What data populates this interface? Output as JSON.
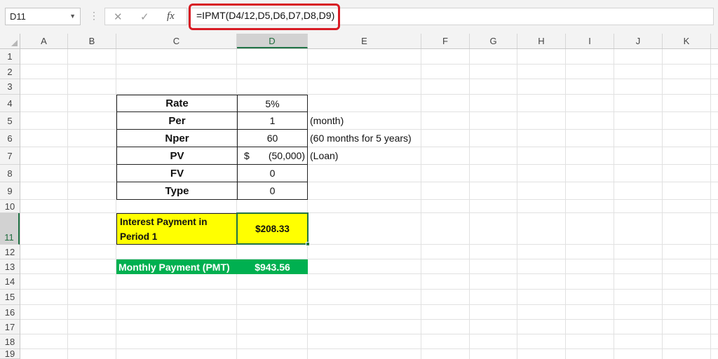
{
  "formula_bar": {
    "name_box": "D11",
    "cancel_icon": "✕",
    "enter_icon": "✓",
    "fx_label": "fx",
    "formula": "=IPMT(D4/12,D5,D6,D7,D8,D9)"
  },
  "columns": [
    "A",
    "B",
    "C",
    "D",
    "E",
    "F",
    "G",
    "H",
    "I",
    "J",
    "K"
  ],
  "rows": [
    "1",
    "2",
    "3",
    "4",
    "5",
    "6",
    "7",
    "8",
    "9",
    "10",
    "11",
    "12",
    "13",
    "14",
    "15",
    "16",
    "17",
    "18",
    "19"
  ],
  "selected_cell": {
    "column": "D",
    "row": "11"
  },
  "table": {
    "rate": {
      "label": "Rate",
      "value": "5%"
    },
    "per": {
      "label": "Per",
      "value": "1",
      "note": "(month)"
    },
    "nper": {
      "label": "Nper",
      "value": "60",
      "note": "(60 months for 5 years)"
    },
    "pv": {
      "label": "PV",
      "currency": "$",
      "value": "(50,000)",
      "note": "(Loan)"
    },
    "fv": {
      "label": "FV",
      "value": "0"
    },
    "type": {
      "label": "Type",
      "value": "0"
    }
  },
  "interest": {
    "label": "Interest Payment in Period 1",
    "value": "$208.33"
  },
  "pmt": {
    "label": "Monthly Payment (PMT)",
    "value": "$943.56"
  },
  "colors": {
    "highlight_red": "#d81b24",
    "yellow": "#ffff00",
    "green": "#00b050",
    "excel_green": "#217346"
  }
}
